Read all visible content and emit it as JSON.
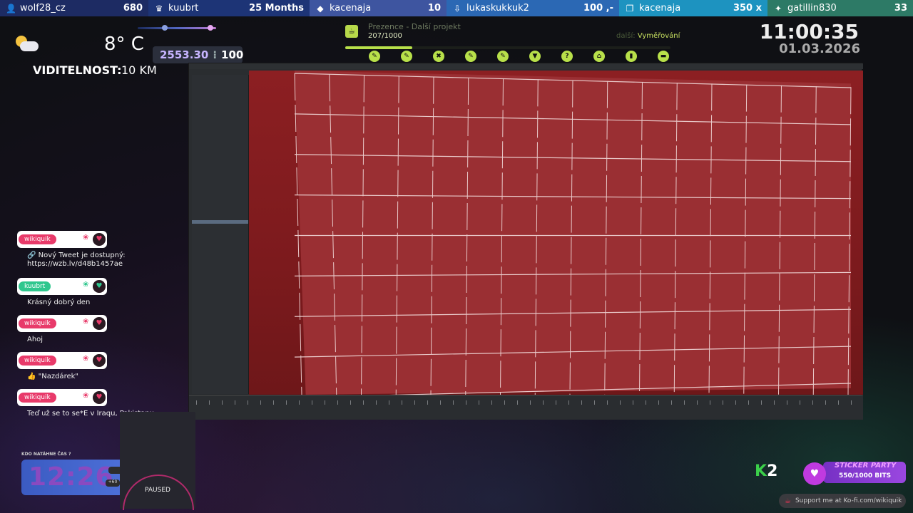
{
  "topbar": [
    {
      "icon": "add-user-icon",
      "glyph": "👤",
      "name": "wolf28_cz",
      "value": "680"
    },
    {
      "icon": "crown-icon",
      "glyph": "♛",
      "name": "kuubrt",
      "value": "25 Months"
    },
    {
      "icon": "diamond-icon",
      "glyph": "◆",
      "name": "kacenaja",
      "value": "10"
    },
    {
      "icon": "bits-icon",
      "glyph": "⇩",
      "name": "lukaskukkuk2",
      "value": "100 ,-"
    },
    {
      "icon": "gift-icon",
      "glyph": "❐",
      "name": "kacenaja",
      "value": "350 x"
    },
    {
      "icon": "trophy-icon",
      "glyph": "✦",
      "name": "gatillin830",
      "value": "33"
    }
  ],
  "weather": {
    "temp": "8° C",
    "visibility_label": "VIDITELNOST:",
    "visibility_value": "10 KM"
  },
  "score": {
    "a": "2553.30",
    "sep": "⁝",
    "b": "100"
  },
  "clock": {
    "time": "11:00:35",
    "date": "01.03.2026"
  },
  "goal": {
    "title": "Prezence - Další projekt",
    "count": "207/1000",
    "progress": 0.207,
    "next_prefix": "další:",
    "next_label": "Vyměřování",
    "milestones": [
      "✎",
      "✎",
      "✖",
      "✎",
      "✎",
      "▼",
      "?",
      "⌂",
      "▮",
      "▬"
    ]
  },
  "chat": [
    {
      "user": "wikiquik",
      "color": "#e83a6a",
      "message": "🔗 Nový Tweet je dostupný: https://wzb.lv/d48b1457ae"
    },
    {
      "user": "kuubrt",
      "color": "#2fc78e",
      "message": "Krásný dobrý den"
    },
    {
      "user": "wikiquik",
      "color": "#e83a6a",
      "message": "Ahoj"
    },
    {
      "user": "wikiquik",
      "color": "#e83a6a",
      "message": "👍 \"Nazdárek\""
    },
    {
      "user": "wikiquik",
      "color": "#e83a6a",
      "message": "Teď už se to se*E v Iraqu, Pakistanu"
    }
  ],
  "timer": {
    "label": "KDO NATÁHNE ČAS ?",
    "value": "12:26",
    "badge": "+60"
  },
  "paused": "PAUSED",
  "k2": {
    "k": "K",
    "two": "2"
  },
  "sticker": {
    "title": "STICKER PARTY",
    "bits": "550/1000 BITS"
  },
  "kofi": "Support me at Ko-fi.com/wikiquik",
  "colors": {
    "viewport": "#8c1f22",
    "accent_green": "#b8e04a",
    "accent_purple": "#9a47e0"
  }
}
